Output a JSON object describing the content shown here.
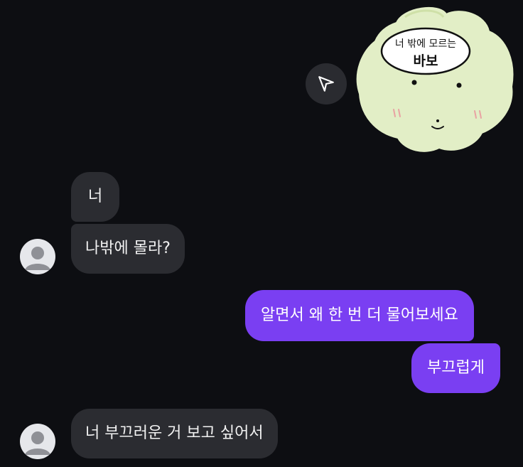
{
  "sticker": {
    "line1": "너 밖에 모르는",
    "line2": "바보"
  },
  "share": {
    "icon": "send-icon"
  },
  "messages": [
    {
      "side": "incoming",
      "text": "너"
    },
    {
      "side": "incoming",
      "text": "나밖에 몰라?"
    },
    {
      "side": "outgoing",
      "text": "알면서 왜 한 번 더 물어보세요"
    },
    {
      "side": "outgoing",
      "text": "부끄럽게"
    },
    {
      "side": "incoming",
      "text": "너 부끄러운 거 보고 싶어서"
    }
  ],
  "colors": {
    "background": "#0d0e12",
    "incoming_bubble": "#2b2c31",
    "outgoing_bubble": "#7a3ff2",
    "sticker_fill": "#e2eec6"
  }
}
